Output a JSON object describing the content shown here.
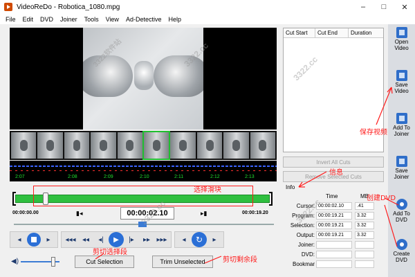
{
  "window": {
    "title": "VideoReDo - Robotica_1080.mpg",
    "controls": [
      "–",
      "□",
      "✕"
    ]
  },
  "menu": [
    "File",
    "Edit",
    "DVD",
    "Joiner",
    "Tools",
    "View",
    "Ad-Detective",
    "Help"
  ],
  "timeline": {
    "ticks": [
      "2:07",
      "2:08",
      "2:09",
      "2:10",
      "2:11",
      "2:12",
      "2:13"
    ],
    "selected_thumb": 5
  },
  "scrubber": {
    "position_fraction": 0.12
  },
  "timecodes": {
    "start": "00:00:00.00",
    "current": "00:00:02.10",
    "end": "00:00:19.20",
    "mark_in": "▮◂",
    "mark_out": "▸▮"
  },
  "transport": {
    "rewind_fast": "◂◂◂",
    "rewind": "◂◂",
    "step_back": "◂|",
    "play": "▶",
    "step_fwd": "|▸",
    "forward": "▸▸",
    "forward_fast": "▸▸▸",
    "prev_frame": "◂",
    "next_frame": "▸"
  },
  "buttons": {
    "cut_selection": "Cut Selection",
    "trim_unselected": "Trim Unselected",
    "invert_all_cuts": "Invert All Cuts",
    "remove_selected_cuts": "Remove Selected Cuts"
  },
  "cutlist": {
    "columns": [
      "Cut Start",
      "Cut End",
      "Duration"
    ]
  },
  "info": {
    "title": "Info",
    "col_time": "Time",
    "col_mb": "MB",
    "rows": [
      {
        "label": "Cursor:",
        "time": "00:00:02.10",
        "mb": ".41"
      },
      {
        "label": "Program:",
        "time": "00:00:19.21",
        "mb": "3.32"
      },
      {
        "label": "Selection:",
        "time": "00:00:19.21",
        "mb": "3.32"
      },
      {
        "label": "Output:",
        "time": "00:00:19.21",
        "mb": "3.32"
      },
      {
        "label": "Joiner:",
        "time": "",
        "mb": ""
      },
      {
        "label": "DVD:",
        "time": "",
        "mb": ""
      },
      {
        "label": "Bookmar",
        "time": "",
        "mb": ""
      }
    ]
  },
  "toolbar": [
    {
      "label1": "Open",
      "label2": "Video",
      "icon": "open-video-icon"
    },
    {
      "label1": "Save",
      "label2": "Video",
      "icon": "save-video-icon"
    },
    {
      "label1": "Add To",
      "label2": "Joiner",
      "icon": "add-to-joiner-icon"
    },
    {
      "label1": "Save",
      "label2": "Joiner",
      "icon": "save-joiner-icon"
    },
    {
      "label1": "Add To",
      "label2": "DVD",
      "icon": "add-to-dvd-icon"
    },
    {
      "label1": "Create",
      "label2": "DVD",
      "icon": "create-dvd-icon"
    }
  ],
  "annotations": {
    "select_block": "选择滑块",
    "save_video": "保存视频",
    "info": "信息",
    "create_dvd": "创建DVD",
    "cut_selection": "剪切选择段",
    "trim_remaining": "剪切剩余段"
  },
  "watermarks": [
    "3322.cc",
    "3322软件站"
  ],
  "colors": {
    "annotation": "#ff1a1a",
    "scrub": "#2fbf3f",
    "accent": "#2b6fd6"
  }
}
